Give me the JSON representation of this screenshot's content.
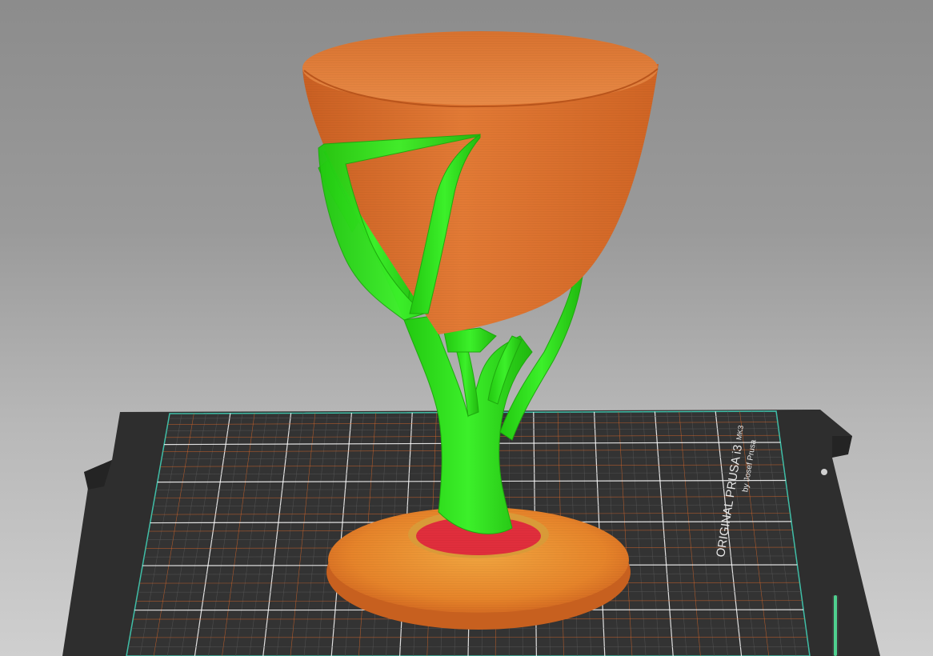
{
  "viewport": {
    "background_color": "#9a9a9a"
  },
  "bed": {
    "brand_line": "ORIGINAL PRUSA i3",
    "model_label": "MK3",
    "byline": "by Josef Prusa",
    "sheet_color": "#2e2e2e",
    "grid_color": "#ffffff",
    "accent_grid_color": "#e06a2a"
  },
  "model": {
    "vase_color": "#e0722e",
    "support_color": "#2fe01c",
    "brim_color": "#e6902a",
    "first_layer_color": "#e02e3c"
  },
  "legend_slider": {
    "color": "#4fcf8f"
  }
}
